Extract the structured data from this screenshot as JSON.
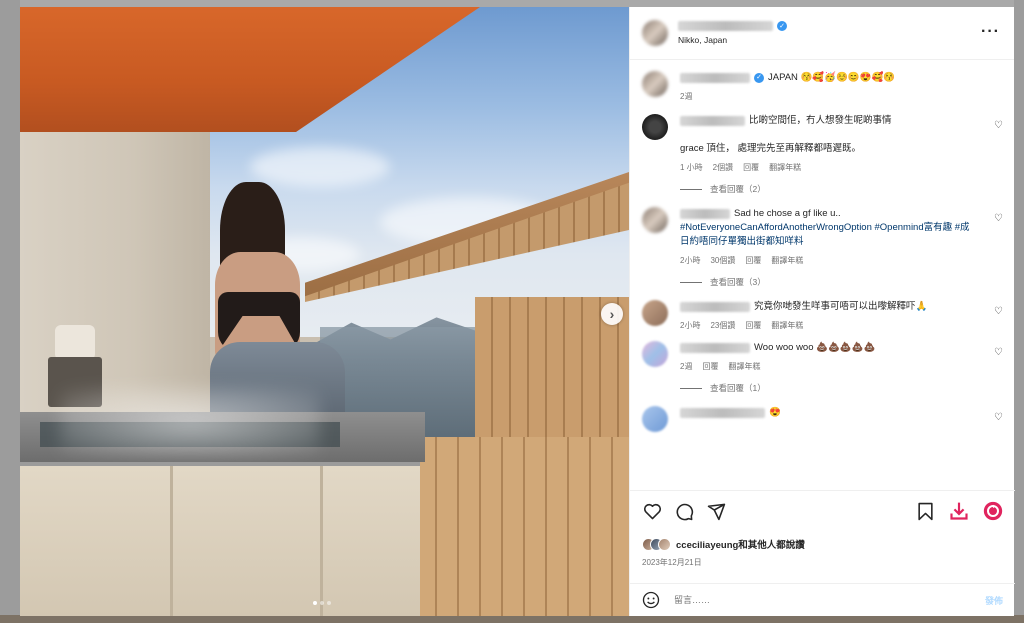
{
  "post": {
    "location": "Nikko, Japan",
    "caption": {
      "text": "JAPAN 😚🥰🥳☺️😊😍🥰😚",
      "time": "2週"
    }
  },
  "comments": [
    {
      "lines": [
        "比啲空間佢，冇人想發生呢啲事情",
        "grace 頂住， 處理完先至再解釋都唔遲既。"
      ],
      "time": "1 小時",
      "likes": "2個讚",
      "reply": "回覆",
      "translate": "翻譯年糕",
      "view_replies": "查看回覆（2）"
    },
    {
      "lines": [
        "Sad he chose a gf like u.."
      ],
      "hashtags": "#NotEveryoneCanAffordAnotherWrongOption #Openmind富有趣 #成日約唔同仔單獨出街都知咩料",
      "time": "2小時",
      "likes": "30個讚",
      "reply": "回覆",
      "translate": "翻譯年糕",
      "view_replies": "查看回覆（3）"
    },
    {
      "lines": [
        "究竟你哋發生咩事可唔可以出嚟解釋吓🙏"
      ],
      "time": "2小時",
      "likes": "23個讚",
      "reply": "回覆",
      "translate": "翻譯年糕"
    },
    {
      "lines": [
        "Woo woo woo 💩💩💩💩💩"
      ],
      "time": "2週",
      "reply": "回覆",
      "translate": "翻譯年糕",
      "view_replies": "查看回覆（1）"
    },
    {
      "lines": [
        "😍"
      ]
    }
  ],
  "likes_line": "cceciliayeung和其他人都說讚",
  "date": "2023年12月21日",
  "composer": {
    "placeholder": "留言……",
    "post_label": "發佈"
  },
  "icons": {
    "like": "heart-icon",
    "comment": "comment-icon",
    "share": "send-icon",
    "save": "bookmark-icon",
    "download": "download-icon",
    "extension": "refresh-badge-icon",
    "more": "more-horizontal-icon",
    "next": "chevron-right-icon",
    "verified": "verified-badge-icon"
  },
  "colors": {
    "accent_red": "#e0245e",
    "link_blue": "#00376b",
    "verified_blue": "#3897f0"
  }
}
